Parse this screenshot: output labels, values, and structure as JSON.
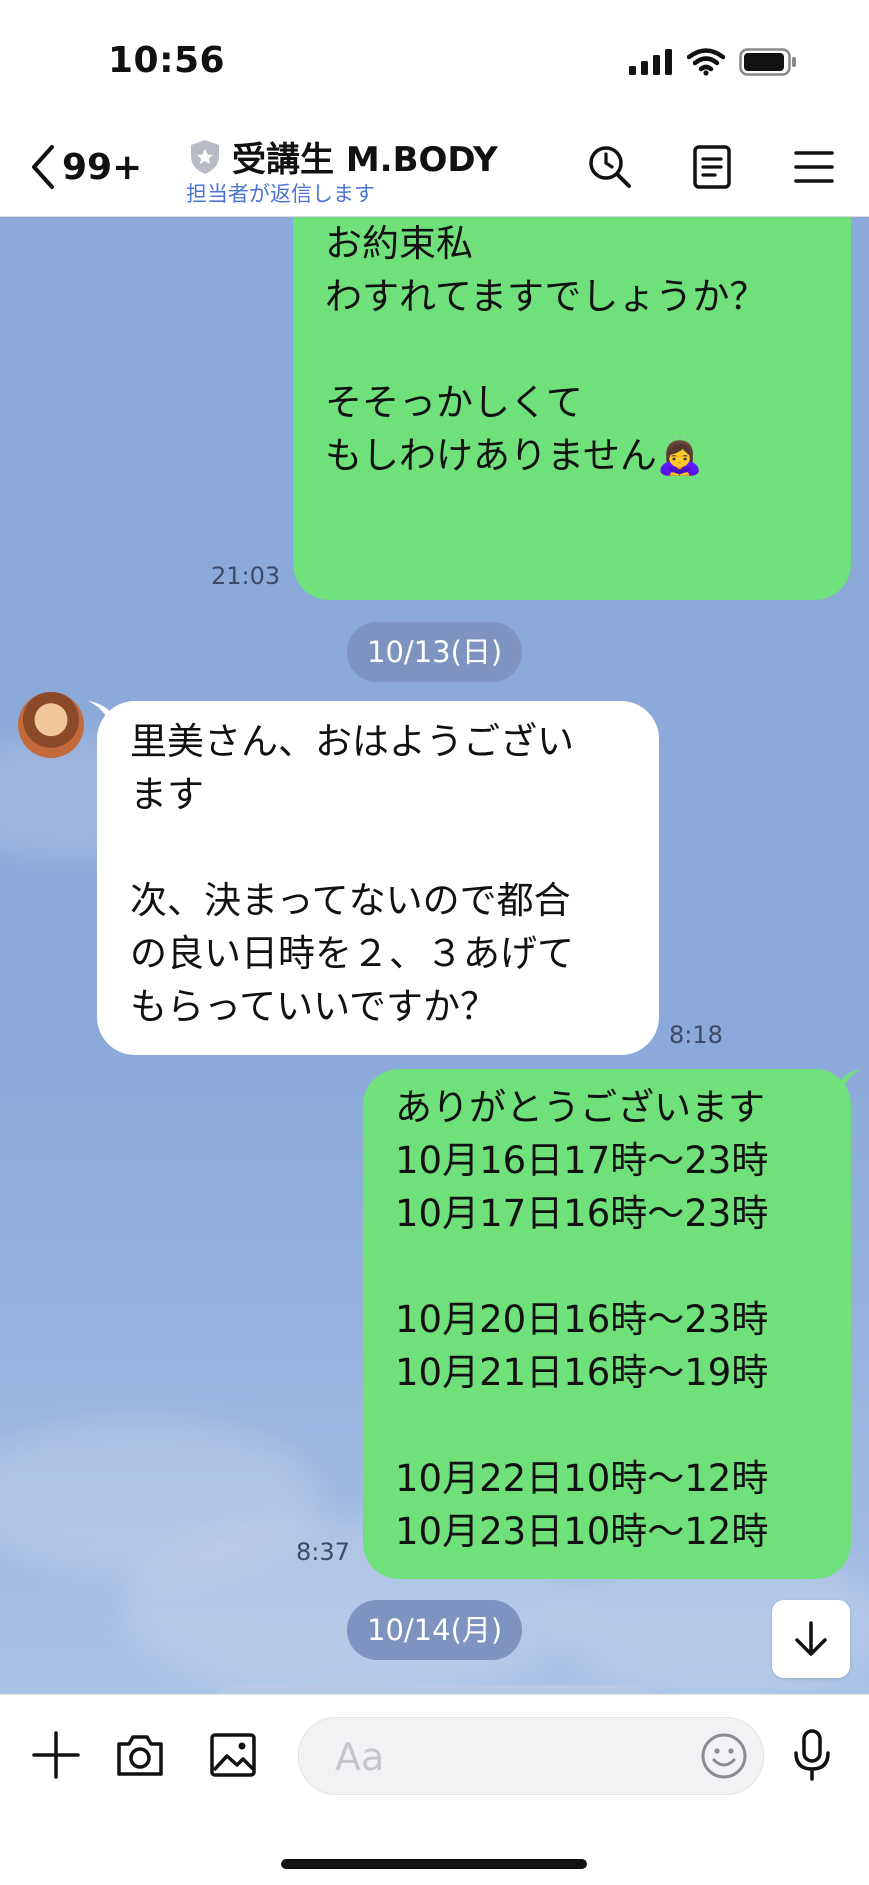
{
  "status_bar": {
    "time": "10:56"
  },
  "header": {
    "back_count": "99+",
    "title": "受講生 M.BODY",
    "subtitle": "担当者が返信します",
    "icons": [
      "clock-search-icon",
      "notes-icon",
      "menu-icon"
    ]
  },
  "messages": [
    {
      "sender": "me",
      "text": "お約束私\nわすれてますでしょうか？\n\nそそっかしくて\nもしわけありません🙇‍♀️",
      "time": "21:03"
    },
    {
      "type": "date",
      "text": "10/13(日)"
    },
    {
      "sender": "them",
      "text": "里美さん、おはようござい\nます\n\n次、決まってないので都合\nの良い日時を２、３あげて\nもらっていいですか？",
      "time": "8:18"
    },
    {
      "sender": "me",
      "text": "ありがとうございます\n10月16日17時〜23時\n10月17日16時〜23時\n\n10月20日16時〜23時\n10月21日16時〜19時\n\n10月22日10時〜12時\n10月23日10時〜12時",
      "time": "8:37"
    },
    {
      "type": "date",
      "text": "10/14(月)"
    }
  ],
  "input": {
    "placeholder": "Aa"
  },
  "colors": {
    "chat_bg": "#8ba9d9",
    "my_bubble": "#6fe07a",
    "their_bubble": "#ffffff",
    "link_blue": "#4d74d4"
  }
}
